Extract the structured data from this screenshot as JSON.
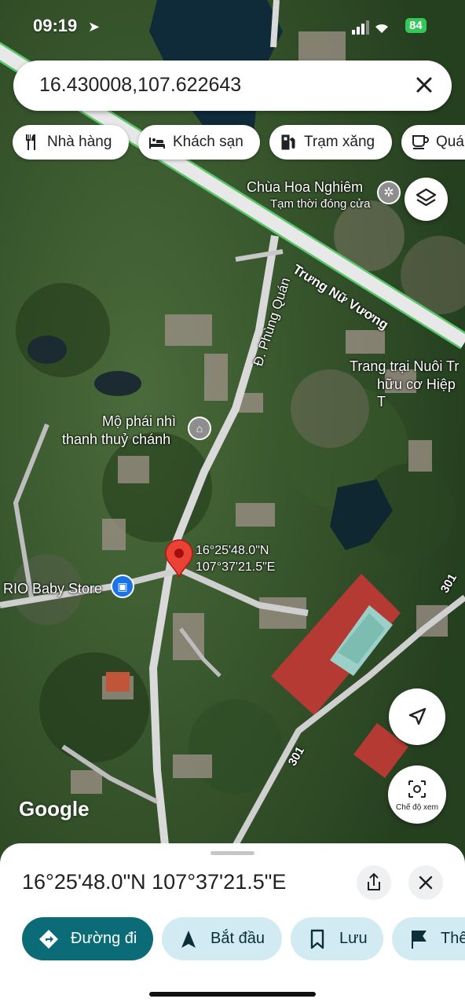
{
  "status_bar": {
    "time": "09:19",
    "battery": "84"
  },
  "search": {
    "query": "16.430008,107.622643"
  },
  "chips": [
    {
      "label": "Nhà hàng",
      "icon": "restaurant-icon"
    },
    {
      "label": "Khách sạn",
      "icon": "hotel-icon"
    },
    {
      "label": "Trạm xăng",
      "icon": "gas-station-icon"
    },
    {
      "label": "Quá",
      "icon": "coffee-icon"
    }
  ],
  "map_labels": {
    "temple_name": "Chùa Hoa Nghiêm",
    "temple_status": "Tạm thời đóng cửa",
    "road_truong": "Trưng Nữ Vương",
    "road_phung": "Đ. Phùng Quán",
    "farm_line1": "Trang trại Nuôi Tr",
    "farm_line2": "hữu cơ Hiệp T",
    "tomb_line1": "Mộ phái nhì",
    "tomb_line2": "thanh thuỷ chánh",
    "store": "RIO Baby Store",
    "route_a": "301",
    "route_b": "301",
    "pin_lat": "16°25'48.0\"N",
    "pin_lng": "107°37'21.5\"E",
    "google": "Google"
  },
  "view_mode_label": "Chế độ xem",
  "sheet": {
    "title": "16°25'48.0\"N 107°37'21.5\"E",
    "actions": [
      {
        "label": "Đường đi",
        "icon": "directions-icon"
      },
      {
        "label": "Bắt đầu",
        "icon": "navigation-arrow-icon"
      },
      {
        "label": "Lưu",
        "icon": "bookmark-icon"
      },
      {
        "label": "Thê",
        "icon": "flag-icon"
      }
    ]
  },
  "colors": {
    "accent": "#0b6b77",
    "action_bg": "#d2ebf2",
    "pin": "#ea4335",
    "road": "#e8e8e8",
    "road_edge": "#57c76b"
  }
}
